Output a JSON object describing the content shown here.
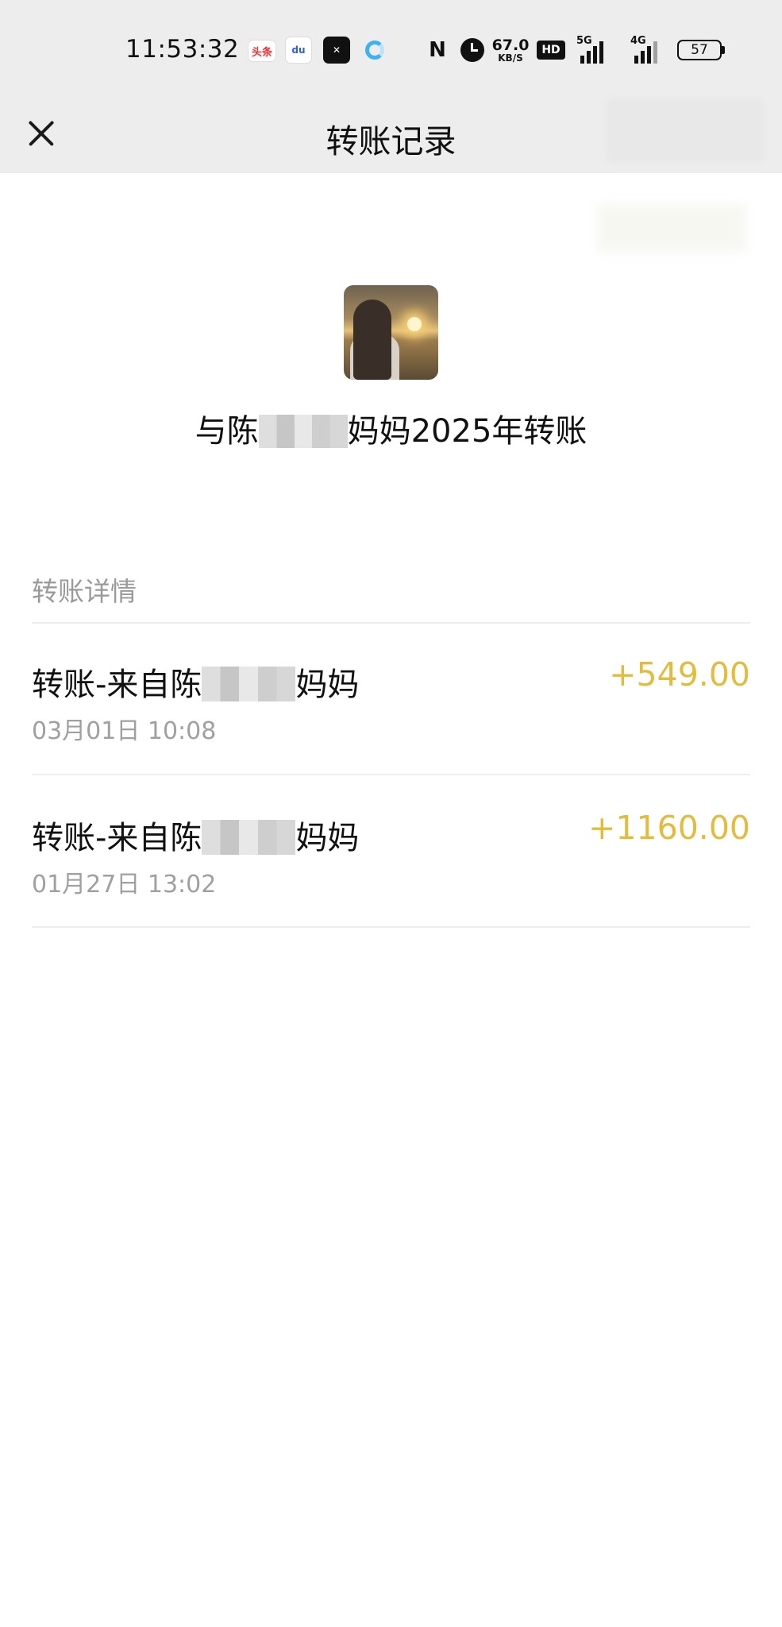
{
  "status_bar": {
    "time": "11:53:32",
    "apps": {
      "toutiao": "头条",
      "baidu": "du"
    },
    "net_speed_value": "67.0",
    "net_speed_unit": "KB/S",
    "hd_label": "HD",
    "signal1_label": "5G",
    "signal2_label": "4G",
    "battery": "57"
  },
  "nav": {
    "title": "转账记录"
  },
  "heading": {
    "prefix": "与陈",
    "suffix": "妈妈2025年转账"
  },
  "section": {
    "label": "转账详情"
  },
  "transfers": [
    {
      "title_prefix": "转账-来自陈",
      "title_suffix": "妈妈",
      "time": "03月01日 10:08",
      "amount": "+549.00"
    },
    {
      "title_prefix": "转账-来自陈",
      "title_suffix": "妈妈",
      "time": "01月27日 13:02",
      "amount": "+1160.00"
    }
  ],
  "colors": {
    "amount": "#e3bc3d",
    "top_band": "#ededed",
    "muted_text": "#9a9a9a"
  },
  "icons": [
    "close-icon",
    "nfc-icon",
    "alarm-icon",
    "battery-icon",
    "signal-icon"
  ]
}
